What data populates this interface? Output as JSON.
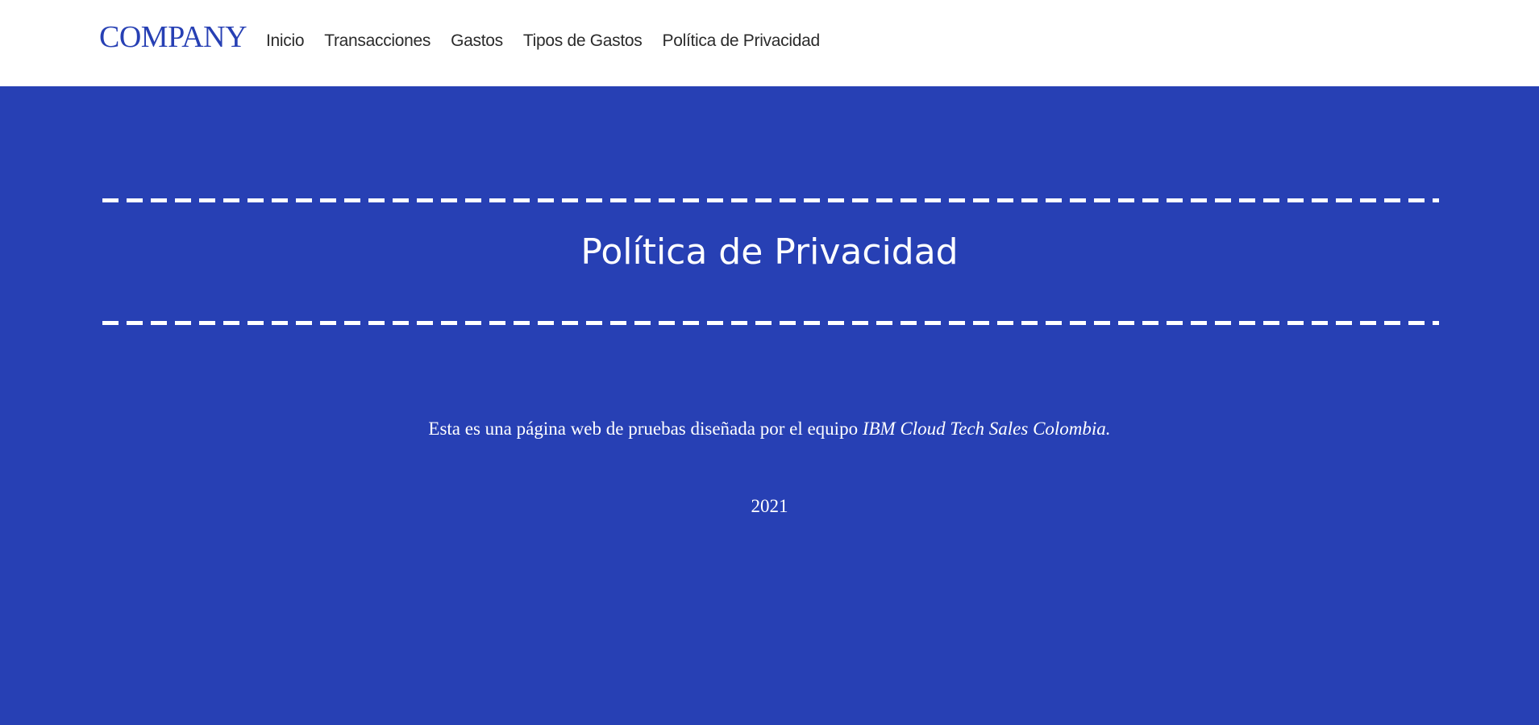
{
  "header": {
    "brand": "COMPANY",
    "nav": [
      {
        "label": "Inicio"
      },
      {
        "label": "Transacciones"
      },
      {
        "label": "Gastos"
      },
      {
        "label": "Tipos de Gastos"
      },
      {
        "label": "Política de Privacidad"
      }
    ]
  },
  "main": {
    "title": "Política de Privacidad",
    "description_prefix": "Esta es una página web de pruebas diseñada por el equipo ",
    "description_team": "IBM Cloud Tech Sales Colombia.",
    "year": "2021"
  },
  "colors": {
    "brand_blue": "#2740b4",
    "navbar_bg": "#ffffff",
    "nav_text": "#2b2b2b",
    "hero_text": "#ffffff"
  }
}
